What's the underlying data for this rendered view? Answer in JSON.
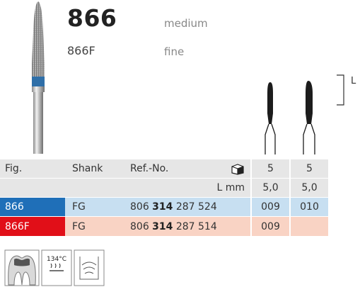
{
  "product": {
    "model": "866",
    "model_grit": "medium",
    "variant": "866F",
    "variant_grit": "fine",
    "length_marker": "L"
  },
  "table": {
    "headers": [
      "Fig.",
      "Shank",
      "Ref.-No.",
      "5",
      "5"
    ],
    "length_row": {
      "label": "L mm",
      "values": [
        "5,0",
        "5,0"
      ]
    },
    "rows": [
      {
        "fig": "866",
        "shank": "FG",
        "ref_pre": "806 ",
        "ref_bold": "314",
        "ref_post": " 287 524",
        "c1": "009",
        "c2": "010",
        "color": "#1f6fb8"
      },
      {
        "fig": "866F",
        "shank": "FG",
        "ref_pre": "806 ",
        "ref_bold": "314",
        "ref_post": " 287 514",
        "c1": "009",
        "c2": "",
        "color": "#e10f18"
      }
    ]
  },
  "icons": {
    "autoclave_temp": "134°C"
  },
  "icon_names": [
    "tooth-icon",
    "autoclave-icon",
    "ultrasonic-bath-icon",
    "package-icon"
  ]
}
